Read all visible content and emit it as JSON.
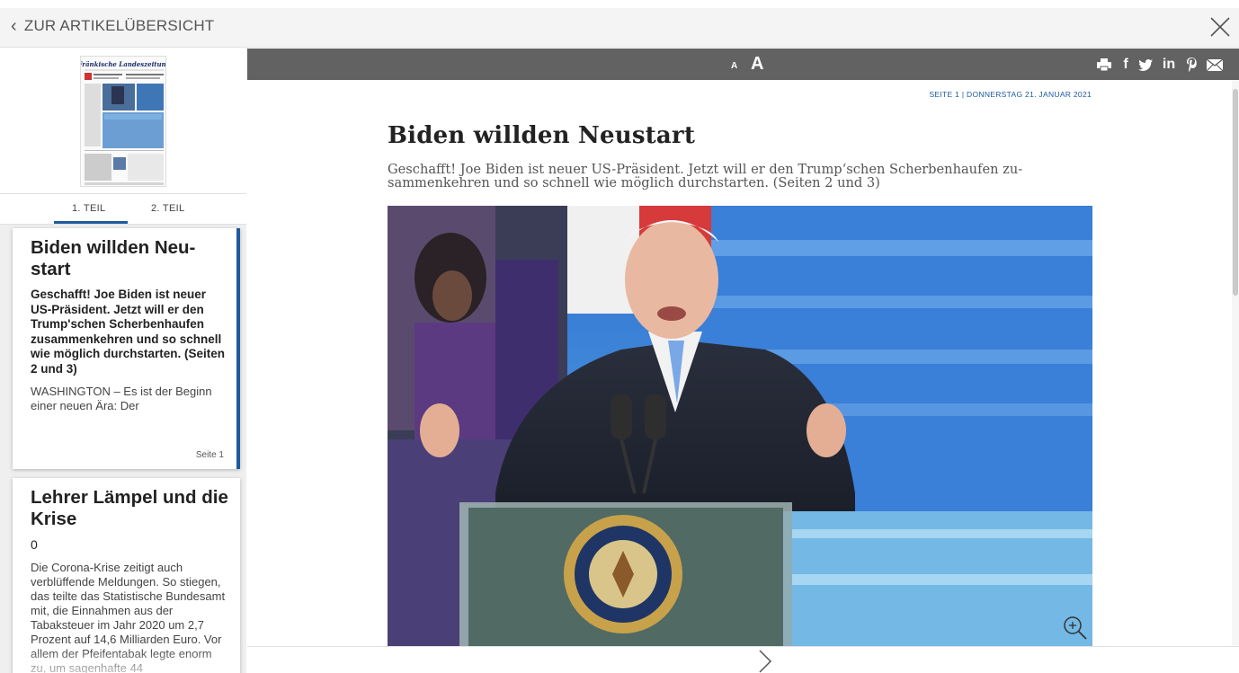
{
  "header": {
    "back_label": "ZUR ARTIKELÜBERSICHT",
    "close_icon": "close-icon"
  },
  "sidebar": {
    "thumbnail_masthead": "Fränkische Landeszeitung",
    "tabs": [
      {
        "label": "1. TEIL",
        "active": true
      },
      {
        "label": "2. TEIL",
        "active": false
      }
    ],
    "articles": [
      {
        "title": "Biden willden Neu-start",
        "lead": "Geschafft! Joe Biden ist neuer US-Präsident. Jetzt will er den Trump'schen Scherbenhaufen zusammenkehren und so schnell wie möglich durchstarten. (Seiten 2 und 3)",
        "body": "WASHINGTON – Es ist der Beginn einer neuen Ära: Der",
        "page": "Seite 1"
      },
      {
        "title": "Lehrer Lämpel und die Krise",
        "lead": "0",
        "body": "Die Corona-Krise zeitigt auch verblüffende Meldungen. So stiegen, das teilte das Statistische Bundesamt mit, die Einnahmen aus der Tabaksteuer im Jahr 2020 um 2,7 Prozent auf 14,6 Milliarden Euro. Vor allem der Pfeifentabak legte enorm zu, um sagenhafte 44"
      }
    ]
  },
  "toolbar": {
    "font_small": "A",
    "font_large": "A",
    "share_icons": [
      "print-icon",
      "facebook-icon",
      "twitter-icon",
      "linkedin-icon",
      "pinterest-icon",
      "mail-icon"
    ]
  },
  "article": {
    "meta": "SEITE 1  |  DONNERSTAG 21. JANUAR 2021",
    "headline": "Biden willden Neustart",
    "subheadline": "Geschafft! Joe Biden ist neuer US-Präsident. Jetzt will er den Trump‘schen Scherbenhaufen zu-sammenkehren und so schnell wie möglich durchstarten. (Seiten 2 und 3)",
    "seal_text": "SEAL OF THE PRESIDENT OF THE UNITED STATES"
  },
  "colors": {
    "accent": "#1e5aa0",
    "toolbar": "#626262",
    "sidebar_bg": "#efefef"
  }
}
